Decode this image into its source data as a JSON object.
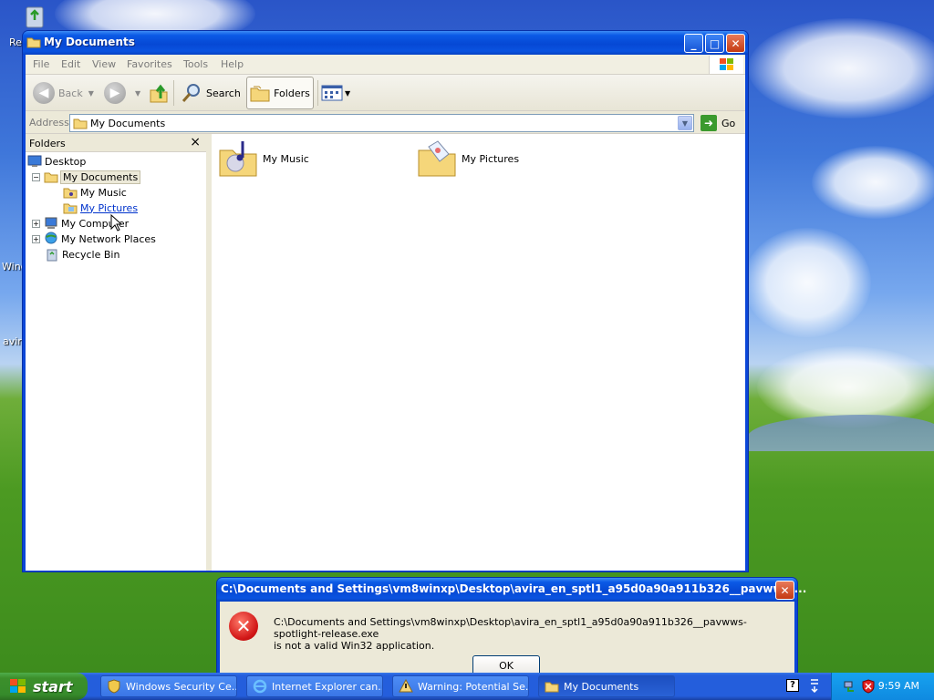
{
  "desktop": {
    "icon_labels": [
      "Re",
      "Winc",
      "avira"
    ]
  },
  "explorer": {
    "title": "My Documents",
    "menu": [
      "File",
      "Edit",
      "View",
      "Favorites",
      "Tools",
      "Help"
    ],
    "toolbar": {
      "back": "Back",
      "search": "Search",
      "folders": "Folders"
    },
    "address": {
      "label": "Address",
      "value": "My Documents",
      "go": "Go"
    },
    "folders_pane": {
      "title": "Folders",
      "close": "×",
      "tree": [
        {
          "label": "Desktop",
          "icon": "desktop-icon"
        },
        {
          "label": "My Documents",
          "icon": "folder-icon",
          "expander": "−",
          "selected": true
        },
        {
          "label": "My Music",
          "icon": "folder-icon"
        },
        {
          "label": "My Pictures",
          "icon": "folder-icon",
          "hover": true
        },
        {
          "label": "My Computer",
          "icon": "computer-icon",
          "expander": "+"
        },
        {
          "label": "My Network Places",
          "icon": "network-icon",
          "expander": "+"
        },
        {
          "label": "Recycle Bin",
          "icon": "recycle-bin-icon"
        }
      ]
    },
    "content": {
      "items": [
        {
          "label": "My Music",
          "icon": "music-folder-icon"
        },
        {
          "label": "My Pictures",
          "icon": "pictures-folder-icon"
        }
      ]
    }
  },
  "error_dialog": {
    "title": "C:\\Documents and Settings\\vm8winxp\\Desktop\\avira_en_sptl1_a95d0a90a911b326__pavwws-...",
    "message_line1": "C:\\Documents and Settings\\vm8winxp\\Desktop\\avira_en_sptl1_a95d0a90a911b326__pavwws-spotlight-release.exe",
    "message_line2": "is not a valid Win32 application.",
    "ok": "OK"
  },
  "taskbar": {
    "start": "start",
    "tasks": [
      {
        "label": "Windows Security Ce...",
        "icon": "shield-icon"
      },
      {
        "label": "Internet Explorer can...",
        "icon": "ie-icon"
      },
      {
        "label": "Warning: Potential Se...",
        "icon": "warning-icon"
      },
      {
        "label": "My Documents",
        "icon": "folder-icon",
        "active": true
      }
    ],
    "clock": "9:59 AM"
  },
  "colors": {
    "title_blue": "#0b5ae6",
    "start_green": "#3c8f2b",
    "tray_blue": "#0f8ae0",
    "error_red": "#d21818"
  }
}
